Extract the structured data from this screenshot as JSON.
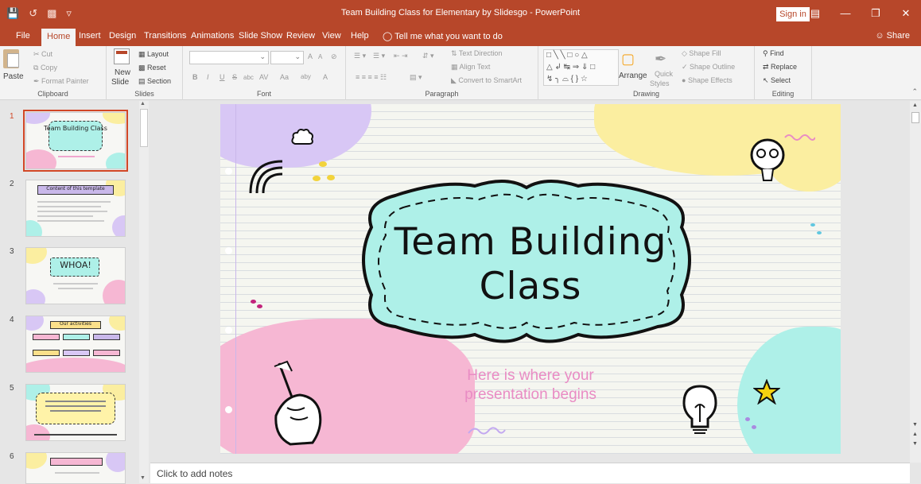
{
  "window": {
    "title": "Team Building Class for Elementary by Slidesgo - PowerPoint",
    "sign_in": "Sign in",
    "qat_icons": [
      "save-icon",
      "undo-icon",
      "slideshow-icon",
      "customize-icon"
    ],
    "accent": "#b7472a"
  },
  "tabs": [
    "File",
    "Home",
    "Insert",
    "Design",
    "Transitions",
    "Animations",
    "Slide Show",
    "Review",
    "View",
    "Help"
  ],
  "active_tab": "Home",
  "tell_me": "Tell me what you want to do",
  "share": "Share",
  "ribbon": {
    "clipboard": {
      "paste": "Paste",
      "cut": "Cut",
      "copy": "Copy",
      "format_painter": "Format Painter",
      "label": "Clipboard"
    },
    "slides": {
      "new_slide": "New",
      "new_slide2": "Slide",
      "layout": "Layout",
      "reset": "Reset",
      "section": "Section",
      "label": "Slides"
    },
    "font": {
      "font_name": "",
      "font_size": "",
      "grow": "A",
      "shrink": "A",
      "bold": "B",
      "italic": "I",
      "underline": "U",
      "strike": "S",
      "shadow": "abc",
      "spacing": "AV",
      "case": "Aa",
      "highlight": "aby",
      "color": "A",
      "label": "Font"
    },
    "paragraph": {
      "text_direction": "Text Direction",
      "align_text": "Align Text",
      "convert_smartart": "Convert to SmartArt",
      "label": "Paragraph"
    },
    "drawing": {
      "arrange": "Arrange",
      "quick_styles": "Quick",
      "quick_styles2": "Styles",
      "shape_fill": "Shape Fill",
      "shape_outline": "Shape Outline",
      "shape_effects": "Shape Effects",
      "label": "Drawing"
    },
    "editing": {
      "find": "Find",
      "replace": "Replace",
      "select": "Select",
      "label": "Editing"
    }
  },
  "thumbnails": [
    {
      "num": "1",
      "title": "Team Building Class",
      "selected": true
    },
    {
      "num": "2",
      "title": "Content of this template",
      "selected": false
    },
    {
      "num": "3",
      "title": "WHOA!",
      "selected": false
    },
    {
      "num": "4",
      "title": "Our activities",
      "selected": false
    },
    {
      "num": "5",
      "title": "",
      "selected": false
    },
    {
      "num": "6",
      "title": "",
      "selected": false
    }
  ],
  "slide": {
    "title_line1": "Team Building",
    "title_line2": "Class",
    "subtitle_line1": "Here is where your",
    "subtitle_line2": "presentation begins",
    "colors": {
      "teal": "#aef0e8",
      "pink": "#f6b7d3",
      "yellow": "#fbeea0",
      "purple": "#d8c7f5",
      "paper": "#f5f6f0",
      "subtitle": "#e98cc4"
    }
  },
  "notes": "Click to add notes"
}
